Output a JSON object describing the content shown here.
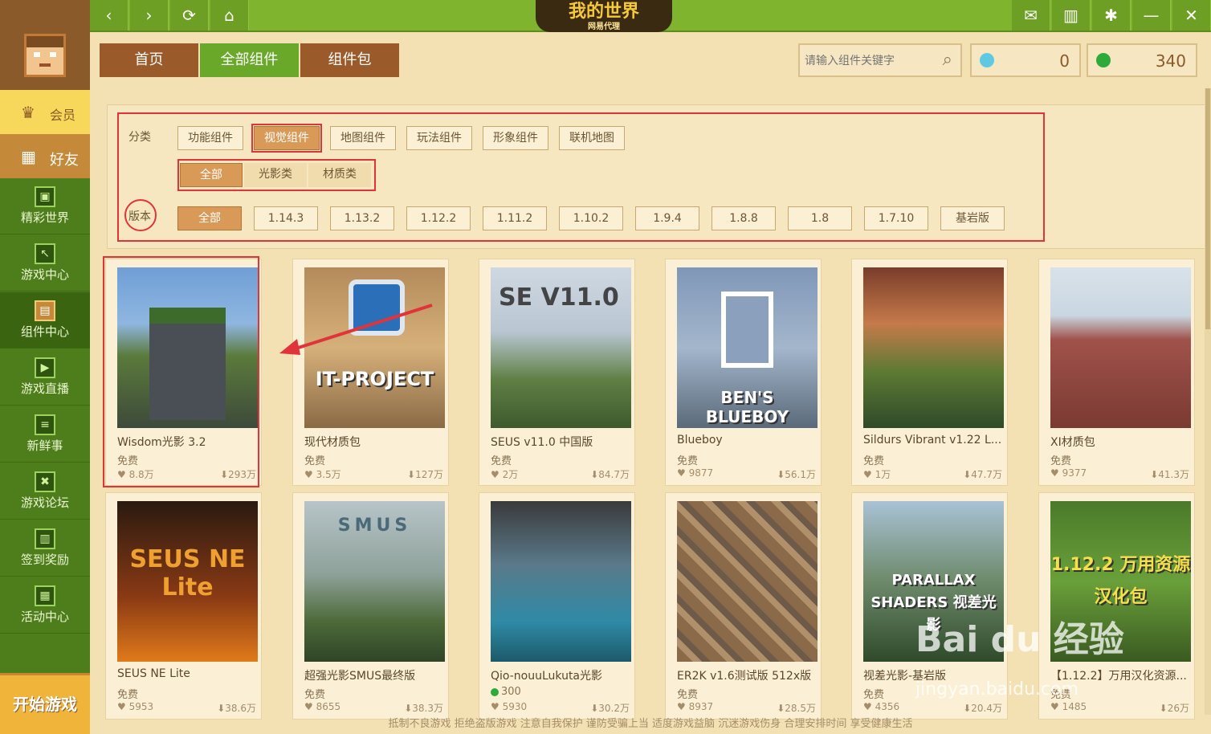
{
  "app": {
    "title": "我的世界",
    "subtitle": "网易代理"
  },
  "topbar": {
    "icons": [
      "back-icon",
      "forward-icon",
      "refresh-icon",
      "home-icon",
      "mail-icon",
      "shirt-icon",
      "gear-icon",
      "minimize-icon",
      "close-icon"
    ]
  },
  "sidebar": {
    "vip": "会员",
    "friends": "好友",
    "items": [
      {
        "label": "精彩世界",
        "icon": "picture-icon"
      },
      {
        "label": "游戏中心",
        "icon": "pickaxe-icon"
      },
      {
        "label": "组件中心",
        "icon": "chest-icon"
      },
      {
        "label": "游戏直播",
        "icon": "play-icon"
      },
      {
        "label": "新鲜事",
        "icon": "news-icon"
      },
      {
        "label": "游戏论坛",
        "icon": "forum-icon"
      },
      {
        "label": "签到奖励",
        "icon": "calendar-icon"
      },
      {
        "label": "活动中心",
        "icon": "gift-icon"
      }
    ],
    "start": "开始游戏"
  },
  "nav": {
    "tabs": [
      "首页",
      "全部组件",
      "组件包"
    ]
  },
  "search": {
    "placeholder": "请输入组件关键字"
  },
  "currency": {
    "diamonds": "0",
    "emeralds": "340"
  },
  "filter": {
    "category_label": "分类",
    "categories": [
      "功能组件",
      "视觉组件",
      "地图组件",
      "玩法组件",
      "形象组件",
      "联机地图"
    ],
    "subcategories": [
      "全部",
      "光影类",
      "材质类"
    ],
    "version_label": "版本",
    "versions": [
      "全部",
      "1.14.3",
      "1.13.2",
      "1.12.2",
      "1.11.2",
      "1.10.2",
      "1.9.4",
      "1.8.8",
      "1.8",
      "1.7.10",
      "基岩版"
    ]
  },
  "cards": [
    {
      "name": "Wisdom光影 3.2",
      "price": "免费",
      "likes": "8.8万",
      "downloads": "293万"
    },
    {
      "name": "现代材质包",
      "price": "免费",
      "likes": "3.5万",
      "downloads": "127万",
      "thumb_text": "IT-PROJECT"
    },
    {
      "name": "SEUS v11.0 中国版",
      "price": "免费",
      "likes": "2万",
      "downloads": "84.7万",
      "thumb_text": "SE V11.0"
    },
    {
      "name": "Blueboy",
      "price": "免费",
      "likes": "9877",
      "downloads": "56.1万",
      "thumb_text": "BEN'S BLUEBOY"
    },
    {
      "name": "Sildurs Vibrant v1.22 L...",
      "price": "免费",
      "likes": "1万",
      "downloads": "47.7万"
    },
    {
      "name": "XI材质包",
      "price": "免费",
      "likes": "9377",
      "downloads": "41.3万"
    },
    {
      "name": "SEUS NE Lite",
      "price": "免费",
      "likes": "5953",
      "downloads": "38.6万",
      "thumb_text": "SEUS NE Lite"
    },
    {
      "name": "超强光影SMUS最终版",
      "price": "免费",
      "likes": "8655",
      "downloads": "38.3万",
      "thumb_text": "SMUS"
    },
    {
      "name": "Qio-nouuLukuta光影",
      "price": "300",
      "likes": "5930",
      "downloads": "30.2万"
    },
    {
      "name": "ER2K v1.6测试版 512x版",
      "price": "免费",
      "likes": "8937",
      "downloads": "28.5万"
    },
    {
      "name": "视差光影-基岩版",
      "price": "免费",
      "likes": "4356",
      "downloads": "20.4万",
      "thumb_text": "PARALLAX SHADERS 视差光影"
    },
    {
      "name": "【1.12.2】万用汉化资源...",
      "price": "免费",
      "likes": "1485",
      "downloads": "26万",
      "thumb_text": "1.12.2 万用资源汉化包"
    }
  ],
  "footer": "抵制不良游戏 拒绝盗版游戏 注意自我保护 谨防受骗上当 适度游戏益脑 沉迷游戏伤身 合理安排时间 享受健康生活",
  "watermark": {
    "brand": "Bai du 经验",
    "url": "jingyan.baidu.com"
  },
  "colors": {
    "accent_green": "#7fb52e",
    "brown": "#9a5a2a",
    "highlight_red": "#e0343a",
    "selected_chip": "#d99a58"
  }
}
